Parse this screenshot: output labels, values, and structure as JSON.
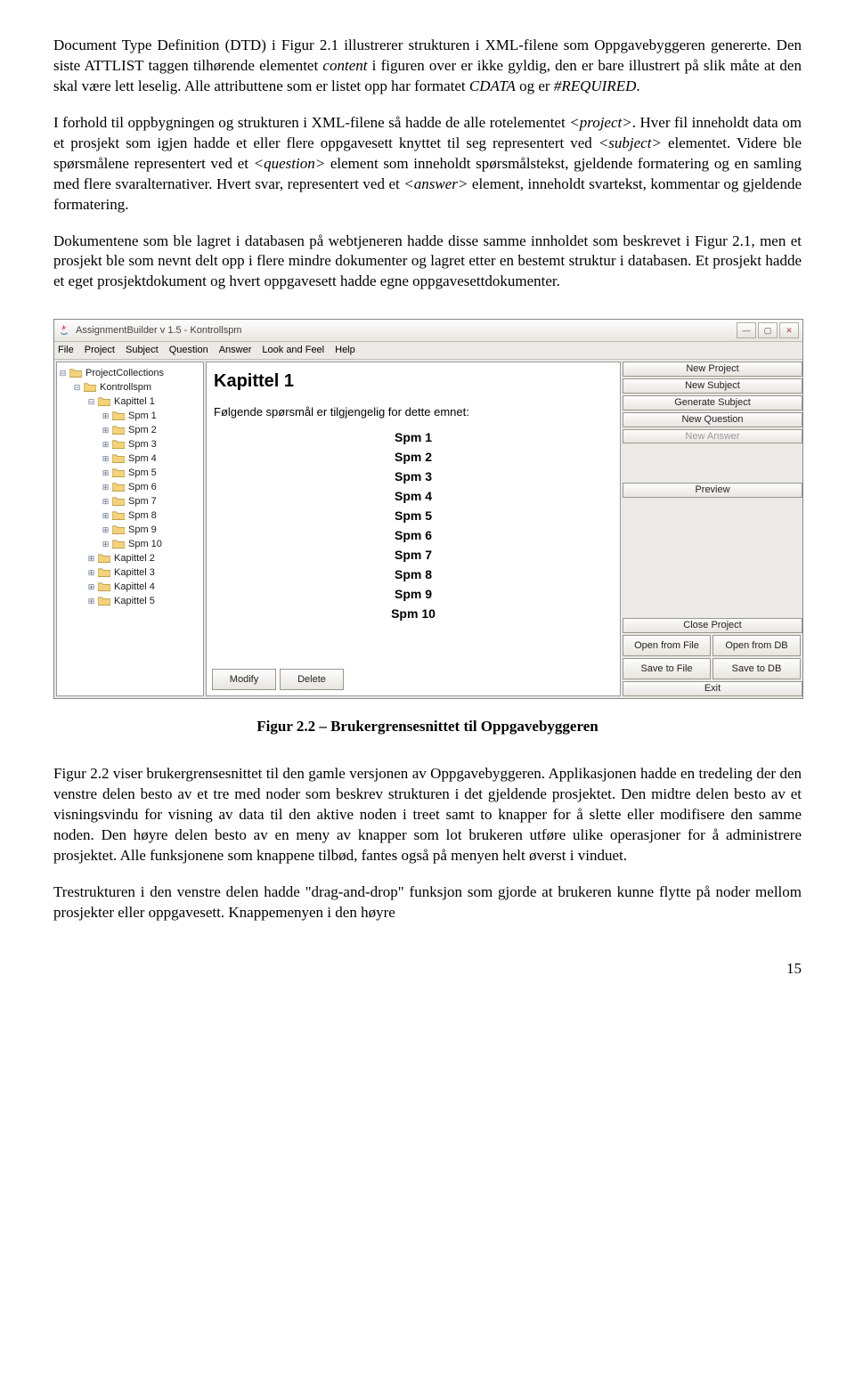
{
  "para1_a": "Document Type Definition (DTD) i Figur 2.1 illustrerer strukturen i XML-filene som Oppgavebyggeren genererte. Den siste ATTLIST taggen tilhørende elementet ",
  "para1_i1": "content",
  "para1_b": " i figuren over er ikke gyldig, den er bare illustrert på slik måte at den skal være lett leselig. Alle attributtene som er listet opp har formatet ",
  "para1_i2": "CDATA",
  "para1_c": " og er ",
  "para1_i3": "#REQUIRED",
  "para1_d": ".",
  "para2_a": "I forhold til oppbygningen og strukturen i XML-filene så hadde de alle rotelementet ",
  "para2_i1": "<project>",
  "para2_b": ". Hver fil inneholdt data om et prosjekt som igjen hadde et eller flere oppgavesett knyttet til seg representert ved ",
  "para2_i2": "<subject>",
  "para2_c": " elementet. Videre ble spørsmålene representert ved et ",
  "para2_i3": "<question>",
  "para2_d": " element som inneholdt spørsmålstekst, gjeldende formatering og en samling med flere svaralternativer. Hvert svar, representert ved et ",
  "para2_i4": "<answer>",
  "para2_e": " element, inneholdt svartekst, kommentar og gjeldende formatering.",
  "para3": "Dokumentene som ble lagret i databasen på webtjeneren hadde disse samme innholdet som beskrevet i Figur 2.1, men et prosjekt ble som nevnt delt opp i flere mindre dokumenter og lagret etter en bestemt struktur i databasen. Et prosjekt hadde et eget prosjektdokument og hvert oppgavesett hadde egne oppgavesettdokumenter.",
  "figcaption": "Figur 2.2 – Brukergrensesnittet til Oppgavebyggeren",
  "para4": "Figur 2.2 viser brukergrensesnittet til den gamle versjonen av Oppgavebyggeren. Applikasjonen hadde en tredeling der den venstre delen besto av et tre med noder som beskrev strukturen i det gjeldende prosjektet. Den midtre delen besto av et visningsvindu for visning av data til den aktive noden i treet samt to knapper for å slette eller modifisere den samme noden. Den høyre delen besto av en meny av knapper som lot brukeren utføre ulike operasjoner for å administrere prosjektet. Alle funksjonene som knappene tilbød, fantes også på menyen helt øverst i vinduet.",
  "para5": "Trestrukturen i den venstre delen hadde \"drag-and-drop\" funksjon som gjorde at brukeren kunne flytte på noder mellom prosjekter eller oppgavesett. Knappemenyen i den høyre",
  "pagenum": "15",
  "app": {
    "title": "AssignmentBuilder v 1.5 - Kontrollspm",
    "menu": [
      "File",
      "Project",
      "Subject",
      "Question",
      "Answer",
      "Look and Feel",
      "Help"
    ],
    "tree_root": "ProjectCollections",
    "tree_project": "Kontrollspm",
    "tree_chapter_open": "Kapittel 1",
    "tree_spm": [
      "Spm 1",
      "Spm 2",
      "Spm 3",
      "Spm 4",
      "Spm 5",
      "Spm 6",
      "Spm 7",
      "Spm 8",
      "Spm 9",
      "Spm 10"
    ],
    "tree_chapters_closed": [
      "Kapittel 2",
      "Kapittel 3",
      "Kapittel 4",
      "Kapittel 5"
    ],
    "center_heading": "Kapittel 1",
    "center_sub": "Følgende spørsmål er tilgjengelig for dette emnet:",
    "center_list": [
      "Spm 1",
      "Spm 2",
      "Spm 3",
      "Spm 4",
      "Spm 5",
      "Spm 6",
      "Spm 7",
      "Spm 8",
      "Spm 9",
      "Spm 10"
    ],
    "btn_modify": "Modify",
    "btn_delete": "Delete",
    "right_buttons": {
      "new_project": "New Project",
      "new_subject": "New Subject",
      "generate_subject": "Generate Subject",
      "new_question": "New Question",
      "new_answer": "New Answer",
      "preview": "Preview",
      "close_project": "Close Project",
      "open_file": "Open from File",
      "open_db": "Open from DB",
      "save_file": "Save to File",
      "save_db": "Save to DB",
      "exit": "Exit"
    }
  }
}
